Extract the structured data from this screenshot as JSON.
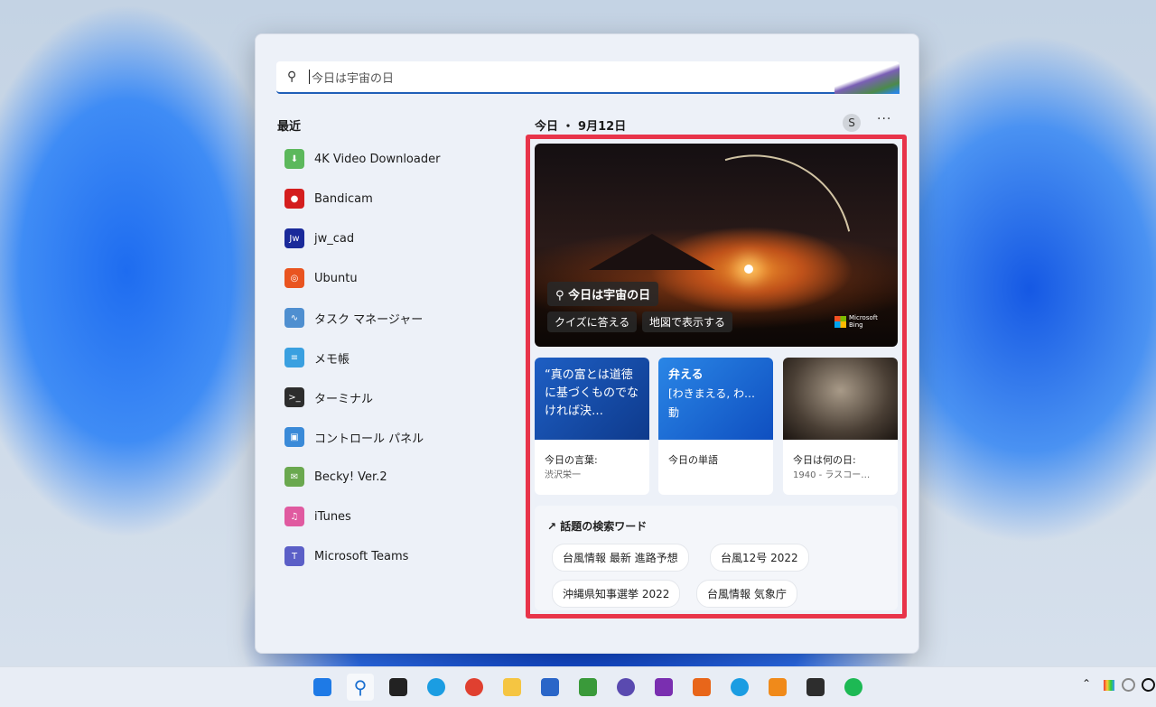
{
  "search": {
    "value": "今日は宇宙の日"
  },
  "recent": {
    "title": "最近",
    "apps": [
      {
        "label": "4K Video Downloader",
        "color": "#5cb85c",
        "glyph": "⬇"
      },
      {
        "label": "Bandicam",
        "color": "#d41e1e",
        "glyph": "●"
      },
      {
        "label": "jw_cad",
        "color": "#1a2a9a",
        "glyph": "Jw"
      },
      {
        "label": "Ubuntu",
        "color": "#e95420",
        "glyph": "◎"
      },
      {
        "label": "タスク マネージャー",
        "color": "#4f8fd0",
        "glyph": "∿"
      },
      {
        "label": "メモ帳",
        "color": "#3aa0e0",
        "glyph": "≡"
      },
      {
        "label": "ターミナル",
        "color": "#2d2d2d",
        "glyph": ">_"
      },
      {
        "label": "コントロール パネル",
        "color": "#3a8ad8",
        "glyph": "▣"
      },
      {
        "label": "Becky! Ver.2",
        "color": "#6aa84f",
        "glyph": "✉"
      },
      {
        "label": "iTunes",
        "color": "#e05aa0",
        "glyph": "♫"
      },
      {
        "label": "Microsoft Teams",
        "color": "#5b5fc7",
        "glyph": "T"
      }
    ]
  },
  "today": {
    "title": "今日 ・ 9月12日",
    "avatar": "S",
    "more": "···",
    "hero": {
      "title": "今日は宇宙の日",
      "quiz": "クイズに答える",
      "map": "地図で表示する",
      "bing": [
        "Microsoft",
        "Bing"
      ]
    },
    "cards": [
      {
        "top": "“真の富とは道徳に基づくものでなければ決…",
        "label": "今日の言葉:",
        "sub": "渋沢栄一"
      },
      {
        "top_bold": "弁える",
        "top": "[わきまえる, わ…動",
        "label": "今日の単語",
        "sub": ""
      },
      {
        "label": "今日は何の日:",
        "sub": "1940 - ラスコー…"
      }
    ],
    "trending": {
      "title": "話題の検索ワード",
      "chips": [
        "台風情報 最新 進路予想",
        "台風12号 2022",
        "沖縄県知事選挙 2022",
        "台風情報 気象庁"
      ]
    }
  },
  "taskbar": {
    "icons": [
      "start",
      "search",
      "task-view",
      "edge",
      "chrome",
      "file-explorer",
      "store",
      "tortoise",
      "p-app",
      "onenote",
      "search-tool",
      "edge-canary",
      "virtualbox",
      "terminal",
      "spotify"
    ]
  }
}
